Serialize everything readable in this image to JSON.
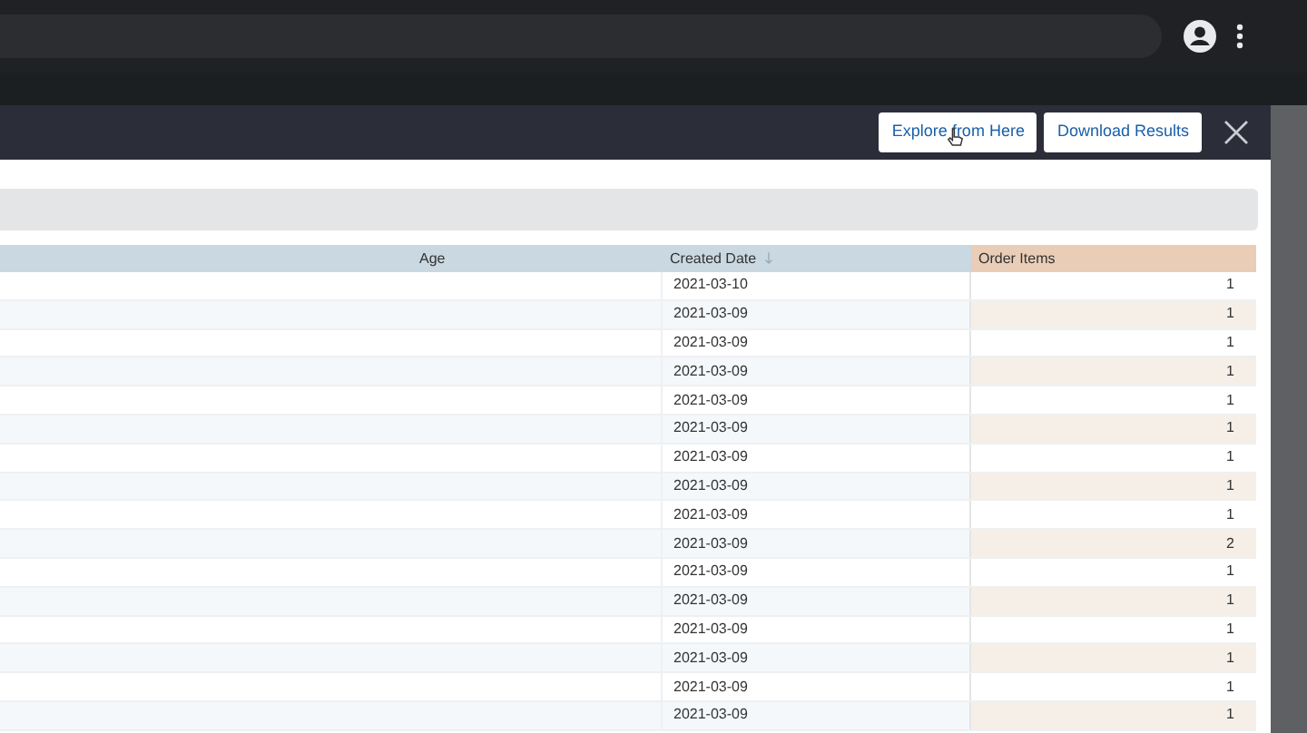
{
  "modal": {
    "buttons": [
      {
        "label": "Explore from Here",
        "hovered": true
      },
      {
        "label": "Download Results",
        "hovered": false
      }
    ]
  },
  "table": {
    "columns": [
      {
        "label": "Age",
        "kind": "dimension",
        "sorted": false
      },
      {
        "label": "Created Date",
        "kind": "dimension",
        "sorted": true
      },
      {
        "label": "Order Items",
        "kind": "measure",
        "sorted": false
      }
    ],
    "rows": [
      {
        "created_date": "2021-03-10",
        "order_items": "1"
      },
      {
        "created_date": "2021-03-09",
        "order_items": "1"
      },
      {
        "created_date": "2021-03-09",
        "order_items": "1"
      },
      {
        "created_date": "2021-03-09",
        "order_items": "1"
      },
      {
        "created_date": "2021-03-09",
        "order_items": "1"
      },
      {
        "created_date": "2021-03-09",
        "order_items": "1"
      },
      {
        "created_date": "2021-03-09",
        "order_items": "1"
      },
      {
        "created_date": "2021-03-09",
        "order_items": "1"
      },
      {
        "created_date": "2021-03-09",
        "order_items": "1"
      },
      {
        "created_date": "2021-03-09",
        "order_items": "2"
      },
      {
        "created_date": "2021-03-09",
        "order_items": "1"
      },
      {
        "created_date": "2021-03-09",
        "order_items": "1"
      },
      {
        "created_date": "2021-03-09",
        "order_items": "1"
      },
      {
        "created_date": "2021-03-09",
        "order_items": "1"
      },
      {
        "created_date": "2021-03-09",
        "order_items": "1"
      },
      {
        "created_date": "2021-03-09",
        "order_items": "1"
      }
    ]
  }
}
